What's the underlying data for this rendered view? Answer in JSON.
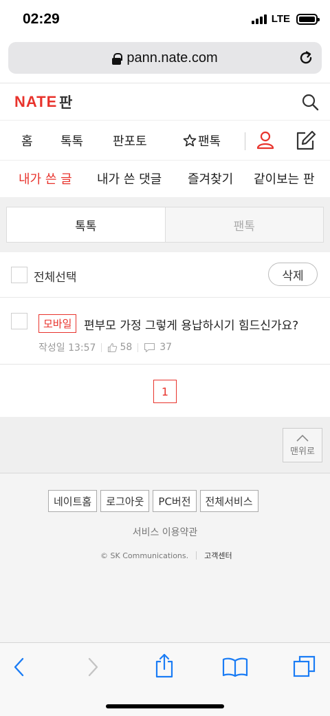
{
  "status": {
    "time": "02:29",
    "network": "LTE"
  },
  "browser": {
    "url": "pann.nate.com"
  },
  "header": {
    "logo": "NATE",
    "title": "판"
  },
  "nav": {
    "home": "홈",
    "toktok": "톡톡",
    "panphoto": "판포토",
    "fantok": "팬톡"
  },
  "subnav": {
    "my_posts": "내가 쓴 글",
    "my_comments": "내가 쓴 댓글",
    "favorites": "즐겨찾기",
    "shared": "같이보는 판"
  },
  "tabs": {
    "toktok": "톡톡",
    "fantok": "팬톡"
  },
  "selection": {
    "select_all": "전체선택",
    "delete": "삭제"
  },
  "posts": [
    {
      "badge": "모바일",
      "title": "편부모 가정 그렇게 용납하시기 힘드신가요?",
      "date": "작성일 13:57",
      "likes": "58",
      "comments": "37"
    }
  ],
  "pagination": {
    "current": "1"
  },
  "footer": {
    "top": "맨위로",
    "links": [
      "네이트홈",
      "로그아웃",
      "PC버전",
      "전체서비스"
    ],
    "terms": "서비스 이용약관",
    "copyright": "© SK Communications.",
    "support": "고객센터"
  },
  "colors": {
    "accent": "#e8332c",
    "ios_blue": "#1a7cf5"
  }
}
